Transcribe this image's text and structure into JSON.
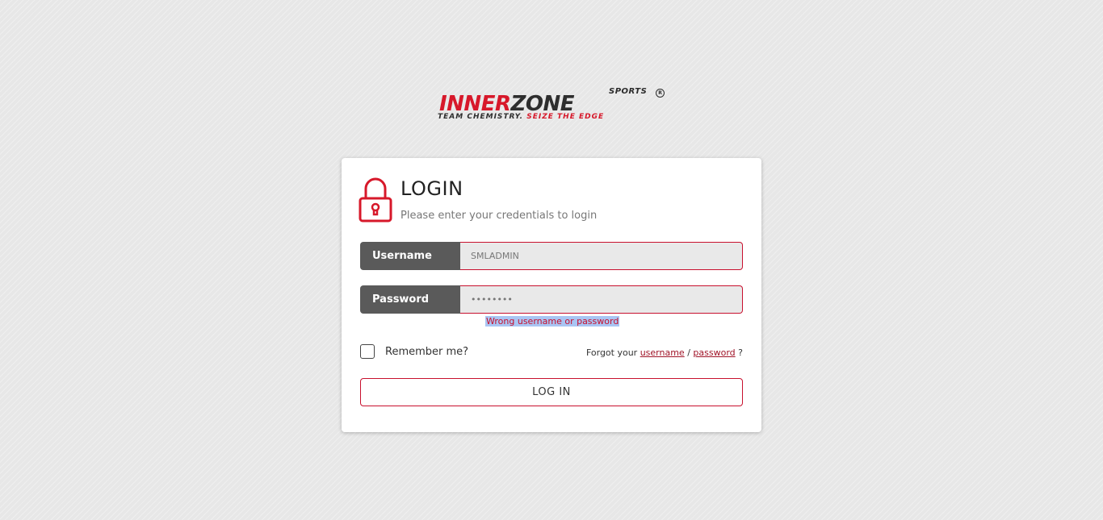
{
  "logo": {
    "sports": "SPORTS",
    "reg_mark": "R",
    "word_inner": "INNER",
    "word_zone": "ZONE",
    "tagline_dark": "TEAM CHEMISTRY.",
    "tagline_red": "SEIZE THE EDGE",
    "colors": {
      "red": "#d7182a",
      "dark": "#2e2e2e"
    }
  },
  "login": {
    "title": "LOGIN",
    "subtitle": "Please enter your credentials to login",
    "icon": "lock-icon",
    "username": {
      "label": "Username",
      "value": "SMLADMIN"
    },
    "password": {
      "label": "Password",
      "value": "••••••••"
    },
    "error": "Wrong username or password",
    "remember_label": "Remember me?",
    "remember_checked": false,
    "forgot_prefix": "Forgot your",
    "forgot_username": "username",
    "forgot_separator": "/",
    "forgot_password": "password",
    "forgot_suffix": "?",
    "submit_label": "LOG IN",
    "accent_color": "#c8102e"
  }
}
